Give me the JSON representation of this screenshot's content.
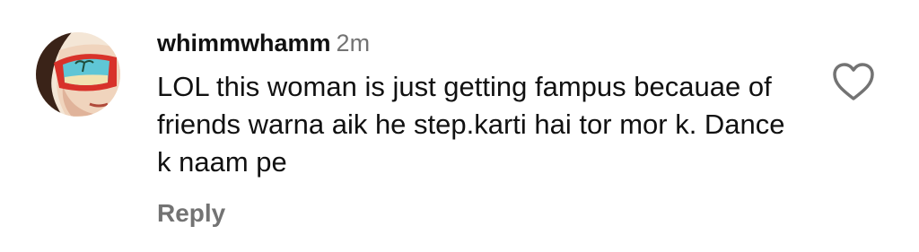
{
  "comment": {
    "username": "whimmwhamm",
    "timestamp": "2m",
    "text": "LOL this woman is just getting fampus becauae of friends warna aik he step.karti hai tor mor k. Dance k naam pe",
    "reply_label": "Reply",
    "like_icon": "heart-outline-icon",
    "avatar_icon": "cartoon-face-sunglasses-avatar"
  },
  "colors": {
    "text": "#111111",
    "secondary": "#737373",
    "background": "#ffffff"
  }
}
